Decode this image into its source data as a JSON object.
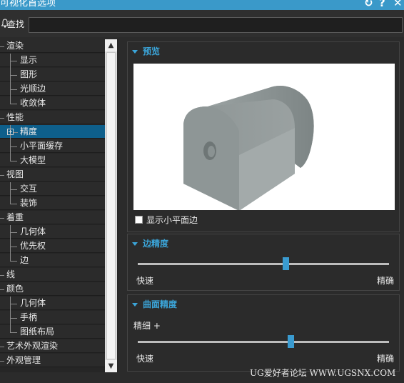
{
  "window": {
    "title": "可视化首选项",
    "icons": [
      "reset-icon",
      "help-icon",
      "close-icon"
    ]
  },
  "search": {
    "label": "查找",
    "value": "",
    "placeholder": ""
  },
  "tree": {
    "items": [
      {
        "label": "渲染",
        "level": 0
      },
      {
        "label": "显示",
        "level": 1
      },
      {
        "label": "图形",
        "level": 1
      },
      {
        "label": "光顺边",
        "level": 1
      },
      {
        "label": "收敛体",
        "level": 1
      },
      {
        "label": "性能",
        "level": 0
      },
      {
        "label": "精度",
        "level": 1,
        "selected": true,
        "expandable": true
      },
      {
        "label": "小平面缓存",
        "level": 1
      },
      {
        "label": "大模型",
        "level": 1
      },
      {
        "label": "视图",
        "level": 0
      },
      {
        "label": "交互",
        "level": 1
      },
      {
        "label": "装饰",
        "level": 1
      },
      {
        "label": "着重",
        "level": 0
      },
      {
        "label": "几何体",
        "level": 1
      },
      {
        "label": "优先权",
        "level": 1
      },
      {
        "label": "边",
        "level": 1
      },
      {
        "label": "线",
        "level": 0
      },
      {
        "label": "颜色",
        "level": 0
      },
      {
        "label": "几何体",
        "level": 1
      },
      {
        "label": "手柄",
        "level": 1
      },
      {
        "label": "图纸布局",
        "level": 1
      },
      {
        "label": "艺术外观渲染",
        "level": 0
      },
      {
        "label": "外观管理",
        "level": 0
      }
    ]
  },
  "preview": {
    "title": "预览",
    "checkbox_label": "显示小平面边",
    "checked": false
  },
  "edge_precision": {
    "title": "边精度",
    "left": "快速",
    "right": "精确",
    "value_fraction": 0.59
  },
  "surface_precision": {
    "title": "曲面精度",
    "sub_label": "精细 +",
    "left": "快速",
    "right": "精确",
    "value_fraction": 0.61
  },
  "watermark": "UG爱好者论坛 WWW.UGSNX.COM",
  "colors": {
    "accent": "#3a99c9",
    "selection": "#0e5f8b",
    "panel_bg": "#2b2b2b",
    "heading": "#3ba5d9"
  }
}
